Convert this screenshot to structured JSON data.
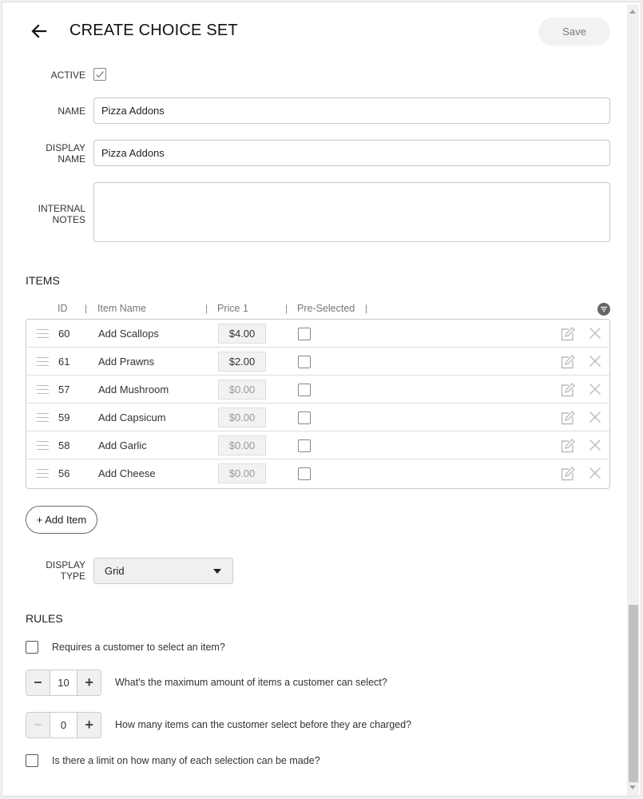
{
  "header": {
    "title": "CREATE CHOICE SET",
    "save_label": "Save",
    "back_icon": "arrow-left-icon"
  },
  "form": {
    "active": {
      "label": "ACTIVE",
      "checked": true
    },
    "name": {
      "label": "NAME",
      "value": "Pizza Addons"
    },
    "display_name": {
      "label_line1": "DISPLAY",
      "label_line2": "NAME",
      "value": "Pizza Addons"
    },
    "internal_notes": {
      "label_line1": "INTERNAL",
      "label_line2": "NOTES",
      "value": ""
    }
  },
  "items": {
    "title": "ITEMS",
    "columns": [
      "ID",
      "Item Name",
      "Price 1",
      "Pre-Selected"
    ],
    "separator": "|",
    "rows": [
      {
        "id": "60",
        "name": "Add Scallops",
        "price": "$4.00",
        "pre_selected": false
      },
      {
        "id": "61",
        "name": "Add Prawns",
        "price": "$2.00",
        "pre_selected": false
      },
      {
        "id": "57",
        "name": "Add Mushroom",
        "price": "$0.00",
        "pre_selected": false
      },
      {
        "id": "59",
        "name": "Add Capsicum",
        "price": "$0.00",
        "pre_selected": false
      },
      {
        "id": "58",
        "name": "Add Garlic",
        "price": "$0.00",
        "pre_selected": false
      },
      {
        "id": "56",
        "name": "Add Cheese",
        "price": "$0.00",
        "pre_selected": false
      }
    ],
    "add_label": "+ Add Item"
  },
  "display_type": {
    "label_line1": "DISPLAY",
    "label_line2": "TYPE",
    "selected": "Grid"
  },
  "rules": {
    "title": "RULES",
    "requires_select": {
      "text": "Requires a customer to select an item?",
      "checked": false
    },
    "max_items": {
      "text": "What's the maximum amount of items a customer can select?",
      "value": "10",
      "minus": "−",
      "plus": "+"
    },
    "free_items": {
      "text": "How many items can the customer select before they are charged?",
      "value": "0",
      "minus": "−",
      "plus": "+"
    },
    "limit_each": {
      "text": "Is there a limit on how many of each selection can be made?",
      "checked": false
    }
  },
  "colors": {
    "muted_price": "#999999",
    "save_bg": "#f2f2f2",
    "icon_grey": "#bbbbbb"
  }
}
